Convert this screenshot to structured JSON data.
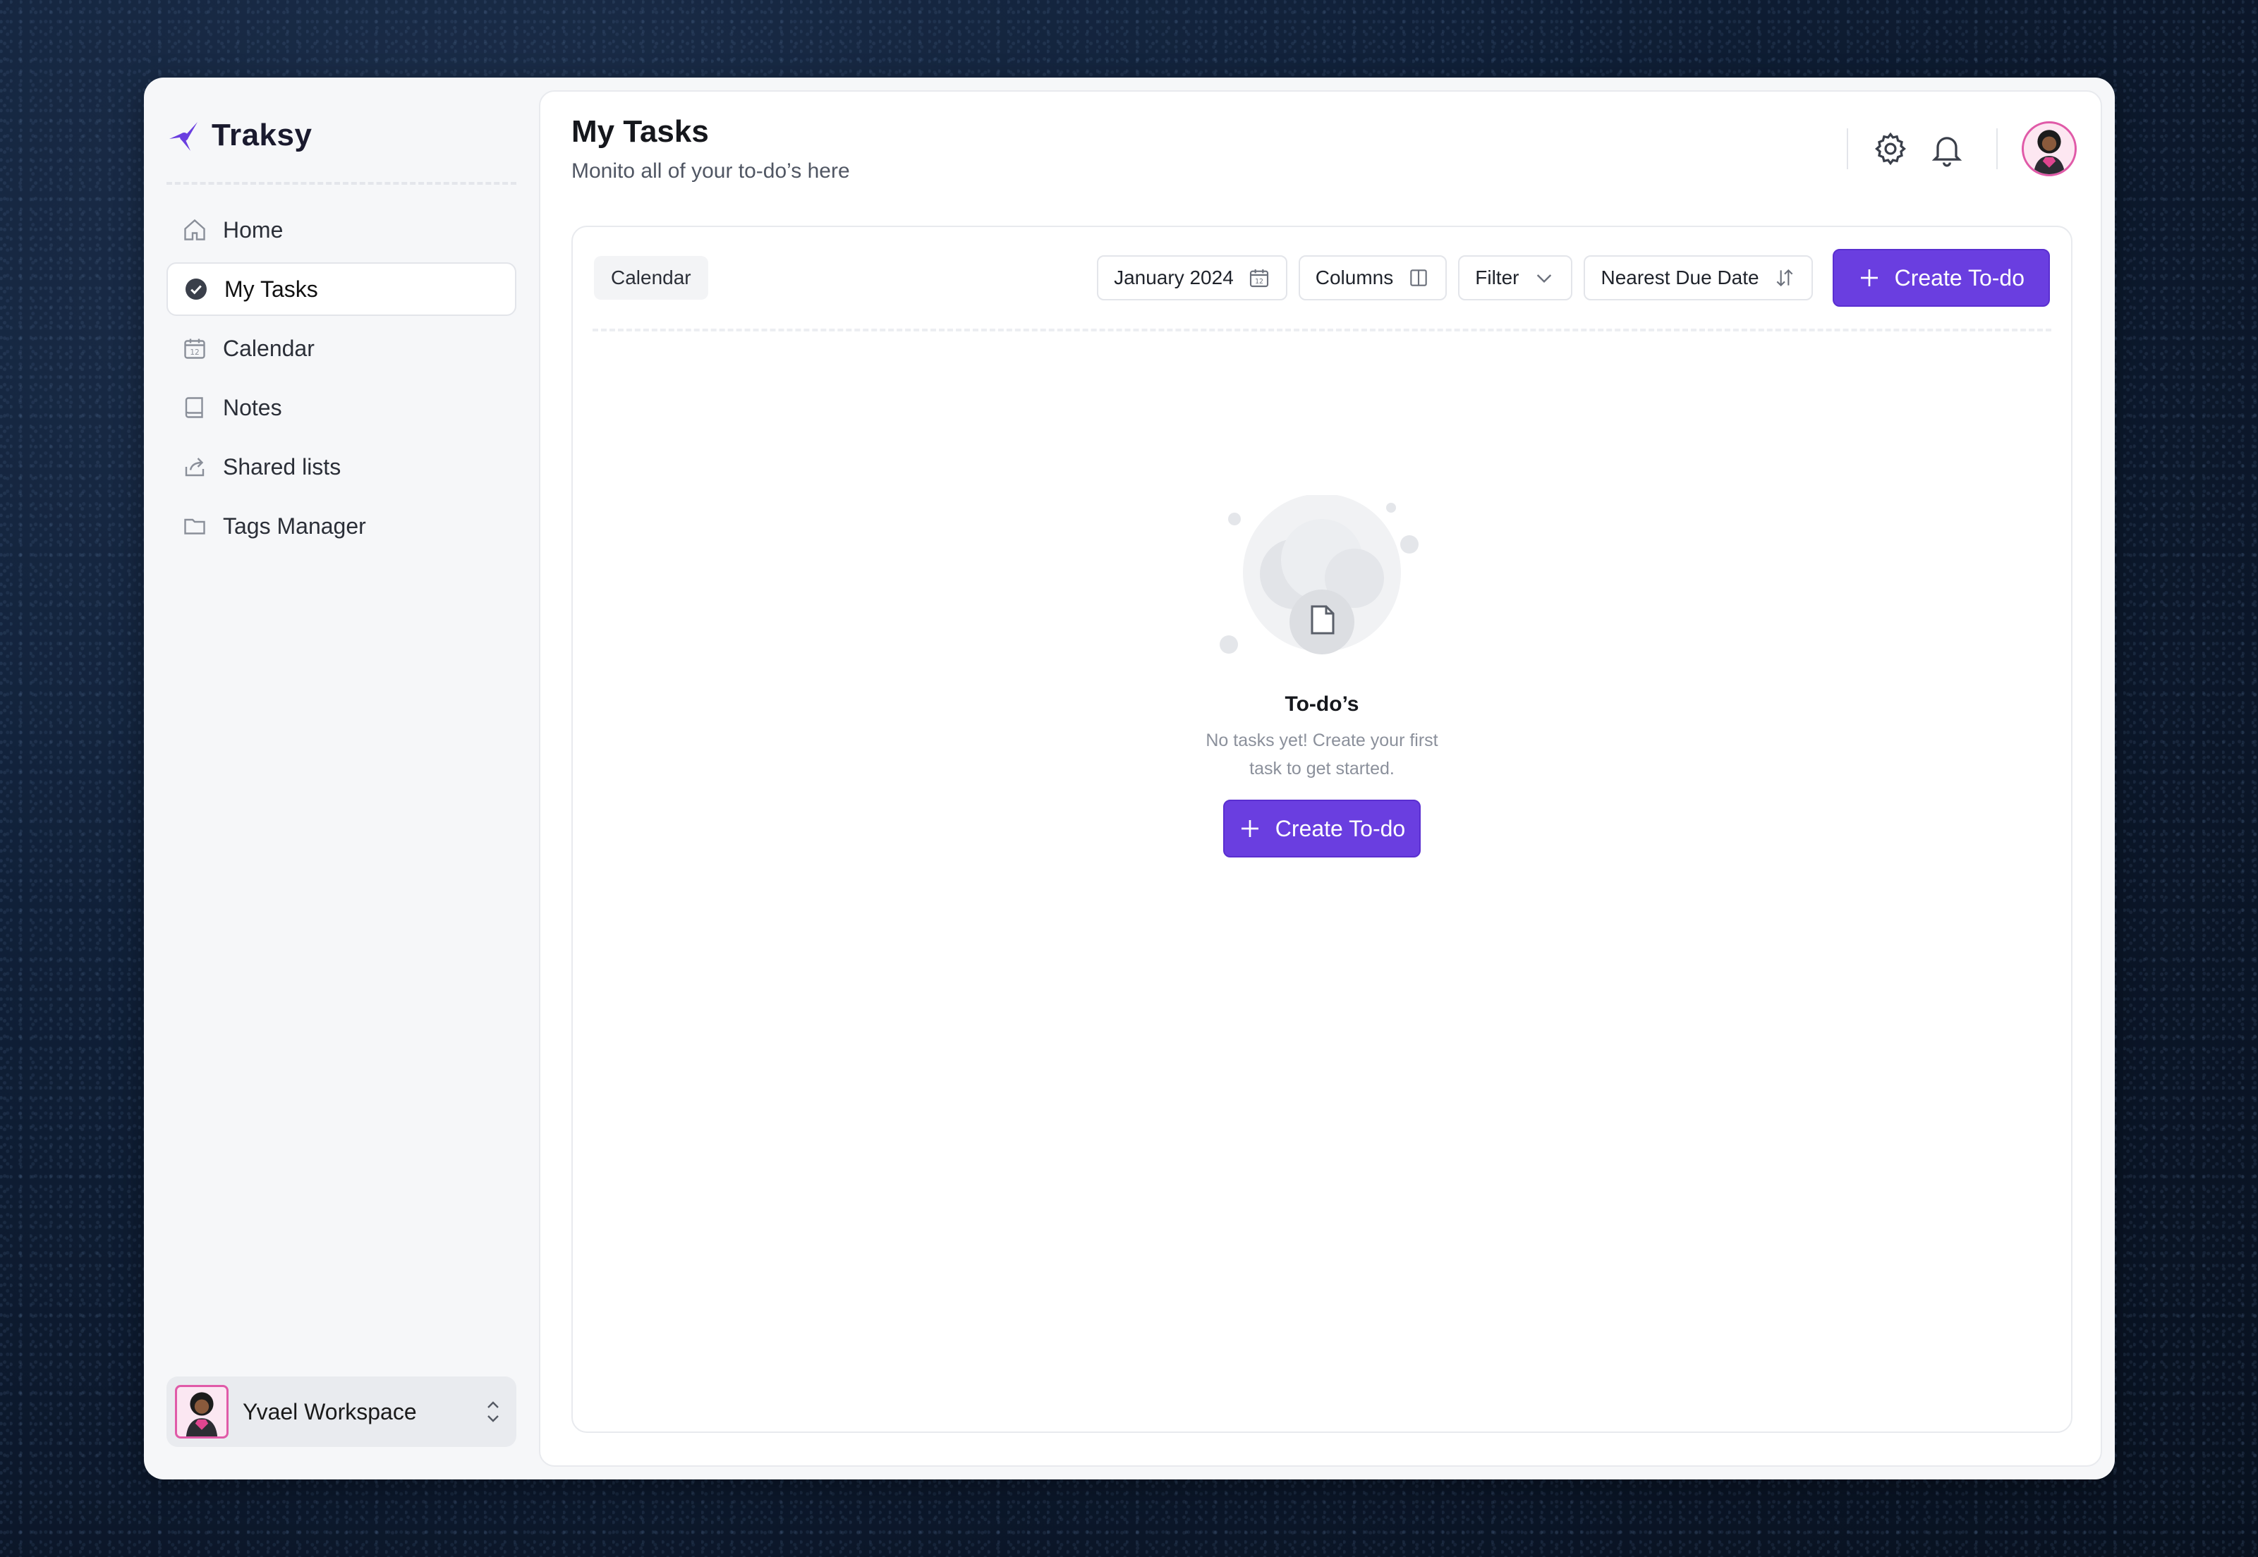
{
  "app": {
    "name": "Traksy"
  },
  "sidebar": {
    "items": [
      {
        "label": "Home",
        "icon": "home-icon"
      },
      {
        "label": "My Tasks",
        "icon": "check-circle-icon",
        "active": true
      },
      {
        "label": "Calendar",
        "icon": "calendar-icon"
      },
      {
        "label": "Notes",
        "icon": "notebook-icon"
      },
      {
        "label": "Shared lists",
        "icon": "share-icon"
      },
      {
        "label": "Tags Manager",
        "icon": "folder-icon"
      }
    ],
    "workspace": {
      "name": "Yvael Workspace"
    }
  },
  "header": {
    "title": "My Tasks",
    "subtitle": "Monito all of your to-do’s here"
  },
  "toolbar": {
    "view_tag": "Calendar",
    "date_label": "January 2024",
    "columns_label": "Columns",
    "filter_label": "Filter",
    "sort_label": "Nearest Due Date",
    "create_label": "Create To-do"
  },
  "empty_state": {
    "title": "To-do’s",
    "text": "No tasks yet! Create your first task to get started.",
    "button_label": "Create To-do"
  },
  "colors": {
    "accent": "#6a3ee0",
    "avatar_border": "#e05aa8"
  }
}
